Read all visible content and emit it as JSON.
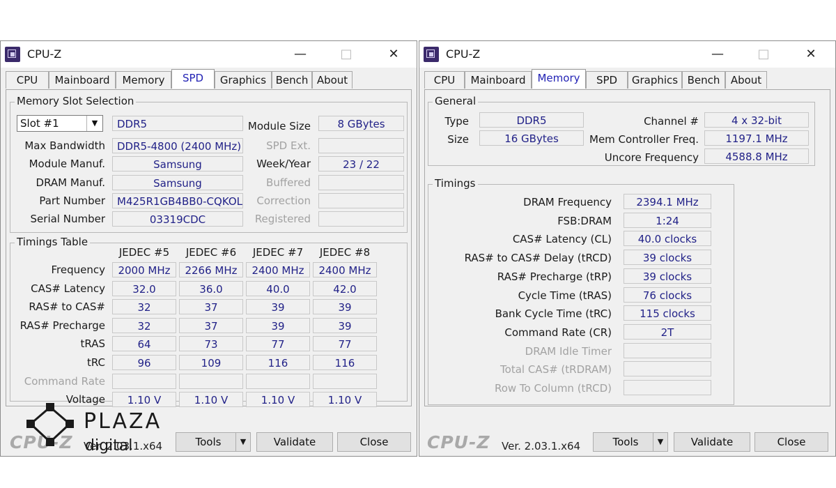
{
  "windows": [
    {
      "title": "CPU-Z",
      "tabs": [
        "CPU",
        "Mainboard",
        "Memory",
        "SPD",
        "Graphics",
        "Bench",
        "About"
      ],
      "active_tab": "SPD",
      "slot_group_title": "Memory Slot Selection",
      "slot_select": "Slot #1",
      "memory_type": "DDR5",
      "fields": {
        "max_bandwidth_label": "Max Bandwidth",
        "max_bandwidth": "DDR5-4800 (2400 MHz)",
        "module_manuf_label": "Module Manuf.",
        "module_manuf": "Samsung",
        "dram_manuf_label": "DRAM Manuf.",
        "dram_manuf": "Samsung",
        "part_number_label": "Part Number",
        "part_number": "M425R1GB4BB0-CQKOL",
        "serial_number_label": "Serial Number",
        "serial_number": "03319CDC",
        "module_size_label": "Module Size",
        "module_size": "8 GBytes",
        "spd_ext_label": "SPD Ext.",
        "spd_ext": "",
        "week_year_label": "Week/Year",
        "week_year": "23 / 22",
        "buffered_label": "Buffered",
        "buffered": "",
        "correction_label": "Correction",
        "correction": "",
        "registered_label": "Registered",
        "registered": ""
      },
      "timings_group_title": "Timings Table",
      "timing_columns": [
        "JEDEC #5",
        "JEDEC #6",
        "JEDEC #7",
        "JEDEC #8"
      ],
      "timing_rows": [
        {
          "label": "Frequency",
          "values": [
            "2000 MHz",
            "2266 MHz",
            "2400 MHz",
            "2400 MHz"
          ]
        },
        {
          "label": "CAS# Latency",
          "values": [
            "32.0",
            "36.0",
            "40.0",
            "42.0"
          ]
        },
        {
          "label": "RAS# to CAS#",
          "values": [
            "32",
            "37",
            "39",
            "39"
          ]
        },
        {
          "label": "RAS# Precharge",
          "values": [
            "32",
            "37",
            "39",
            "39"
          ]
        },
        {
          "label": "tRAS",
          "values": [
            "64",
            "73",
            "77",
            "77"
          ]
        },
        {
          "label": "tRC",
          "values": [
            "96",
            "109",
            "116",
            "116"
          ]
        },
        {
          "label": "Command Rate",
          "values": [
            "",
            "",
            "",
            ""
          ]
        },
        {
          "label": "Voltage",
          "values": [
            "1.10 V",
            "1.10 V",
            "1.10 V",
            "1.10 V"
          ]
        }
      ],
      "footer": {
        "logo": "CPU-Z",
        "version": "Ver. 2.03.1.x64",
        "tools": "Tools",
        "validate": "Validate",
        "close": "Close"
      }
    },
    {
      "title": "CPU-Z",
      "tabs": [
        "CPU",
        "Mainboard",
        "Memory",
        "SPD",
        "Graphics",
        "Bench",
        "About"
      ],
      "active_tab": "Memory",
      "general_group_title": "General",
      "general": {
        "type_label": "Type",
        "type": "DDR5",
        "size_label": "Size",
        "size": "16 GBytes",
        "channel_label": "Channel #",
        "channel": "4 x 32-bit",
        "mem_ctrl_label": "Mem Controller Freq.",
        "mem_ctrl": "1197.1 MHz",
        "uncore_label": "Uncore Frequency",
        "uncore": "4588.8 MHz"
      },
      "timings_group_title": "Timings",
      "timings": [
        {
          "label": "DRAM Frequency",
          "value": "2394.1 MHz"
        },
        {
          "label": "FSB:DRAM",
          "value": "1:24"
        },
        {
          "label": "CAS# Latency (CL)",
          "value": "40.0 clocks"
        },
        {
          "label": "RAS# to CAS# Delay (tRCD)",
          "value": "39 clocks"
        },
        {
          "label": "RAS# Precharge (tRP)",
          "value": "39 clocks"
        },
        {
          "label": "Cycle Time (tRAS)",
          "value": "76 clocks"
        },
        {
          "label": "Bank Cycle Time (tRC)",
          "value": "115 clocks"
        },
        {
          "label": "Command Rate (CR)",
          "value": "2T"
        },
        {
          "label": "DRAM Idle Timer",
          "value": ""
        },
        {
          "label": "Total CAS# (tRDRAM)",
          "value": ""
        },
        {
          "label": "Row To Column (tRCD)",
          "value": ""
        }
      ],
      "footer": {
        "logo": "CPU-Z",
        "version": "Ver. 2.03.1.x64",
        "tools": "Tools",
        "validate": "Validate",
        "close": "Close"
      }
    }
  ],
  "watermark": {
    "line1": "PLAZA",
    "line2": "digital"
  }
}
